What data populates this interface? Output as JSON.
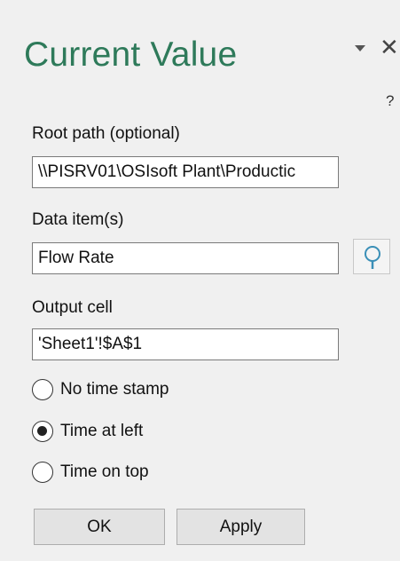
{
  "pane": {
    "title": "Current Value",
    "help": "?"
  },
  "root_path": {
    "label": "Root path (optional)",
    "value": "\\\\PISRV01\\OSIsoft Plant\\Productic"
  },
  "data_items": {
    "label": "Data item(s)",
    "value": "Flow Rate",
    "search_icon": "search-icon"
  },
  "output_cell": {
    "label": "Output cell",
    "value": "'Sheet1'!$A$1"
  },
  "timestamp_options": [
    {
      "label": "No time stamp",
      "selected": false
    },
    {
      "label": "Time at left",
      "selected": true
    },
    {
      "label": "Time on top",
      "selected": false
    }
  ],
  "buttons": {
    "ok": "OK",
    "apply": "Apply"
  },
  "colors": {
    "title": "#2e7a5a",
    "search_icon": "#3a8fb7",
    "background": "#f0f0f0"
  }
}
